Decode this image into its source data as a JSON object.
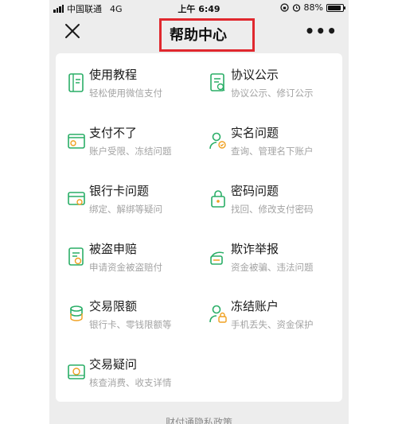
{
  "status_bar": {
    "carrier": "中国联通",
    "network": "4G",
    "time": "上午 6:49",
    "battery_pct": "88%",
    "battery_level": 0.88
  },
  "nav": {
    "title": "帮助中心",
    "close_icon": "close-icon",
    "more_icon": "more-icon",
    "more_glyph": "•••",
    "highlight_color": "#e0282e"
  },
  "accent_color": "#2aae67",
  "items": [
    {
      "title": "使用教程",
      "subtitle": "轻松使用微信支付",
      "icon": "book-icon"
    },
    {
      "title": "协议公示",
      "subtitle": "协议公示、修订公示",
      "icon": "document-search-icon"
    },
    {
      "title": "支付不了",
      "subtitle": "账户受限、冻结问题",
      "icon": "wallet-icon"
    },
    {
      "title": "实名问题",
      "subtitle": "查询、管理名下账户",
      "icon": "user-check-icon"
    },
    {
      "title": "银行卡问题",
      "subtitle": "绑定、解绑等疑问",
      "icon": "bank-card-icon"
    },
    {
      "title": "密码问题",
      "subtitle": "找回、修改支付密码",
      "icon": "lock-icon"
    },
    {
      "title": "被盗申赔",
      "subtitle": "申请资金被盗赔付",
      "icon": "claim-document-icon"
    },
    {
      "title": "欺诈举报",
      "subtitle": "资金被骗、违法问题",
      "icon": "report-icon"
    },
    {
      "title": "交易限额",
      "subtitle": "银行卡、零钱限额等",
      "icon": "coins-icon"
    },
    {
      "title": "冻结账户",
      "subtitle": "手机丢失、资金保护",
      "icon": "lock-account-icon"
    },
    {
      "title": "交易疑问",
      "subtitle": "核查消费、收支详情",
      "icon": "transaction-icon"
    }
  ],
  "footer": {
    "link": "财付通隐私政策"
  }
}
